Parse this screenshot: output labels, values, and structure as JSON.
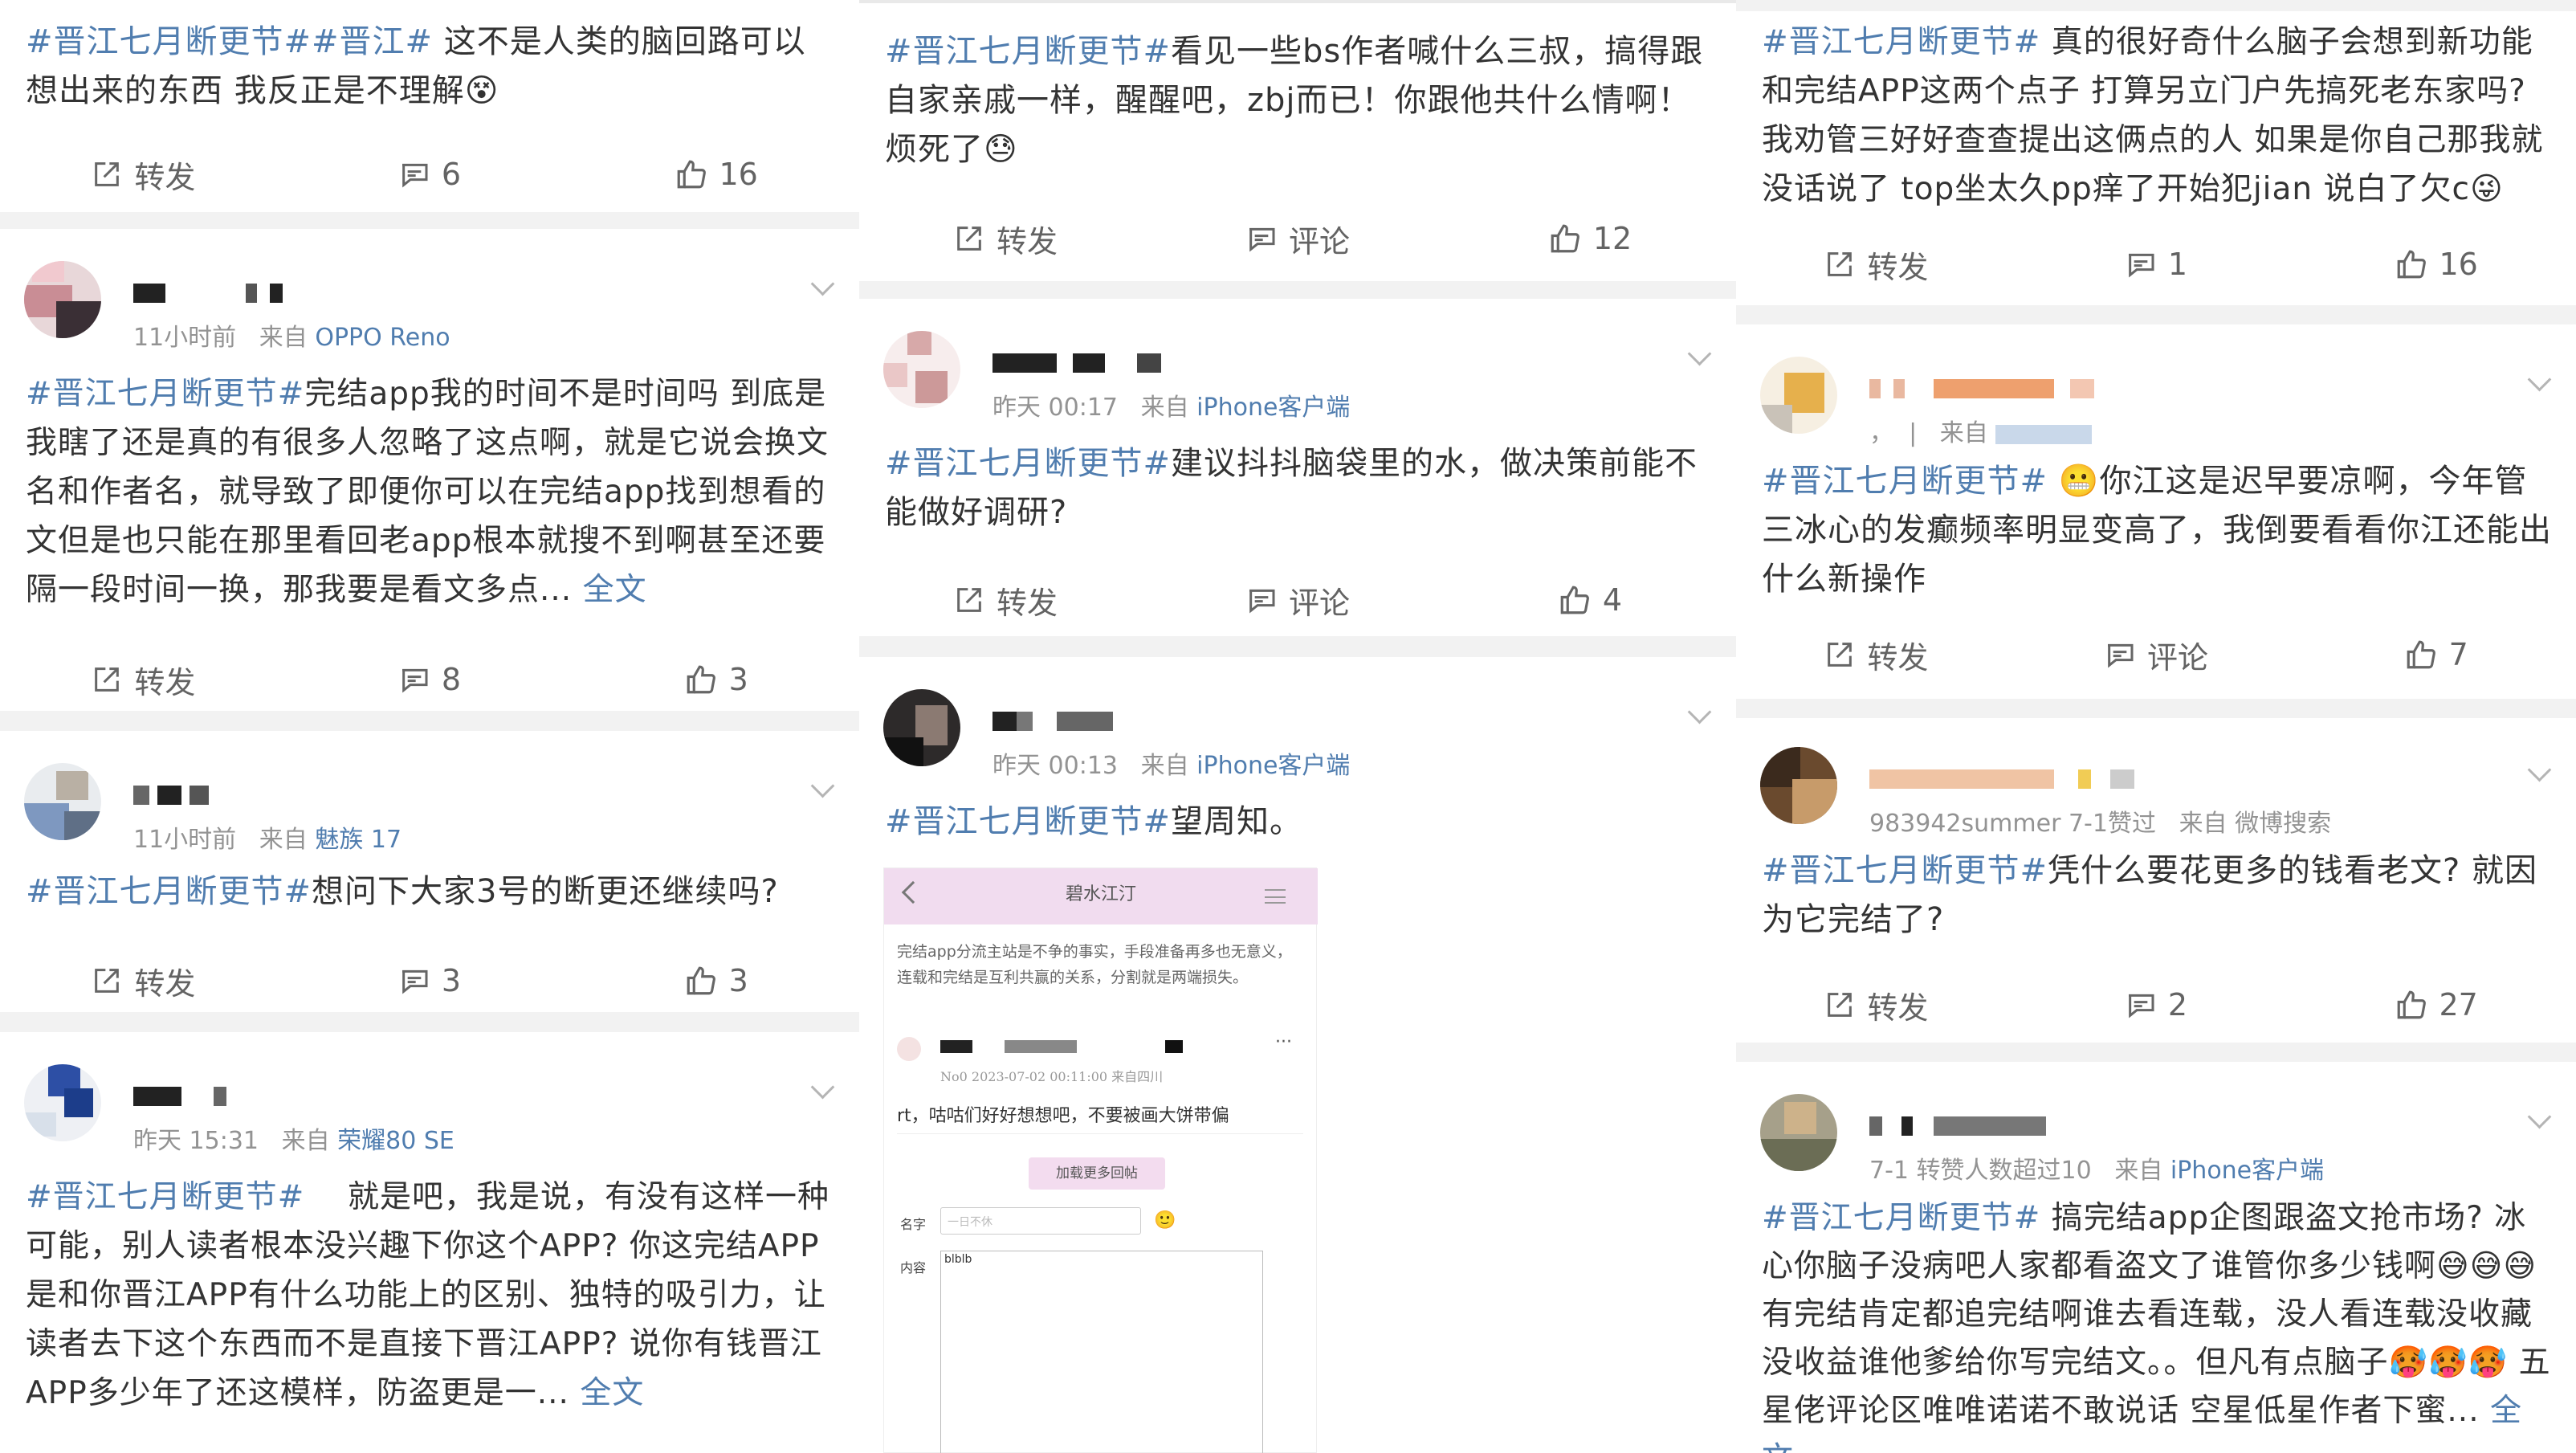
{
  "actions": {
    "repost": "转发",
    "comment": "评论"
  },
  "full_text": "全文",
  "col1": [
    {
      "tags": "#晋江七月断更节##晋江#",
      "text": "这不是人类的脑回路可以想出来的东西 我反正是不理解",
      "comments": "6",
      "likes": "16"
    },
    {
      "time": "11小时前",
      "from": "来自",
      "device": "OPPO Reno",
      "tags": "#晋江七月断更节#",
      "text": "完结app我的时间不是时间吗 到底是我瞎了还是真的有很多人忽略了这点啊，就是它说会换文名和作者名，就导致了即便你可以在完结app找到想看的文但是也只能在那里看回老app根本就搜不到啊甚至还要隔一段时间一换，那我要是看文多点...",
      "comments": "8",
      "likes": "3"
    },
    {
      "time": "11小时前",
      "from": "来自",
      "device": "魅族 17",
      "tags": "#晋江七月断更节#",
      "text": "想问下大家3号的断更还继续吗?",
      "comments": "3",
      "likes": "3"
    },
    {
      "time": "昨天 15:31",
      "from": "来自",
      "device": "荣耀80 SE",
      "tags": "#晋江七月断更节#",
      "text": "就是吧，我是说，有没有这样一种可能，别人读者根本没兴趣下你这个APP? 你这完结APP是和你晋江APP有什么功能上的区别、独特的吸引力，让读者去下这个东西而不是直接下晋江APP? 说你有钱晋江APP多少年了还这模样，防盗更是一..."
    }
  ],
  "col2": [
    {
      "tags": "#晋江七月断更节#",
      "text": "看见一些bs作者喊什么三叔，搞得跟自家亲戚一样，醒醒吧，zbj而已！你跟他共什么情啊！烦死了",
      "likes": "12"
    },
    {
      "time": "昨天 00:17",
      "from": "来自",
      "device": "iPhone客户端",
      "tags": "#晋江七月断更节#",
      "text": "建议抖抖脑袋里的水，做决策前能不能做好调研?",
      "likes": "4"
    },
    {
      "time": "昨天 00:13",
      "from": "来自",
      "device": "iPhone客户端",
      "tags": "#晋江七月断更节#",
      "text": "望周知。"
    }
  ],
  "embed": {
    "title": "碧水江汀",
    "body": "完结app分流主站是不争的事实，手段准备再多也无意义，连载和完结是互利共赢的关系，分割就是两端损失。",
    "floor": "No0  2023-07-02 00:11:00  来自四川",
    "post": "rt，咕咕们好好想想吧，不要被画大饼带偏",
    "load_more": "加载更多回帖",
    "name_label": "名字",
    "name_placeholder": "一日不休",
    "content_label": "内容",
    "content_value": "blblb"
  },
  "col3": [
    {
      "tags": "#晋江七月断更节#",
      "text": "真的很好奇什么脑子会想到新功能和完结APP这两个点子 打算另立门户先搞死老东家吗? 我劝管三好好查查提出这俩点的人 如果是你自己那我就没话说了 top坐太久pp痒了开始犯jian 说白了欠c",
      "comments": "1",
      "likes": "16"
    },
    {
      "from": "来自",
      "tags": "#晋江七月断更节#",
      "text": "你江这是迟早要凉啊，今年管三冰心的发癫频率明显变高了，我倒要看看你江还能出什么新操作",
      "likes": "7"
    },
    {
      "time": "983942summer 7-1赞过",
      "from": "来自",
      "device": "微博搜索",
      "tags": "#晋江七月断更节#",
      "text": "凭什么要花更多的钱看老文? 就因为它完结了?",
      "comments": "2",
      "likes": "27"
    },
    {
      "time": "7-1 转赞人数超过10",
      "from": "来自",
      "device": "iPhone客户端",
      "tags": "#晋江七月断更节#",
      "text": "搞完结app企图跟盗文抢市场? 冰心你脑子没病吧人家都看盗文了谁管你多少钱啊😅😅😅有完结肯定都追完结啊谁去看连载，没人看连载没收藏没收益谁他爹给你写完结文。。但凡有点脑子🥵🥵🥵 五星佬评论区唯唯诺诺不敢说话 空星低星作者下蜜..."
    }
  ]
}
